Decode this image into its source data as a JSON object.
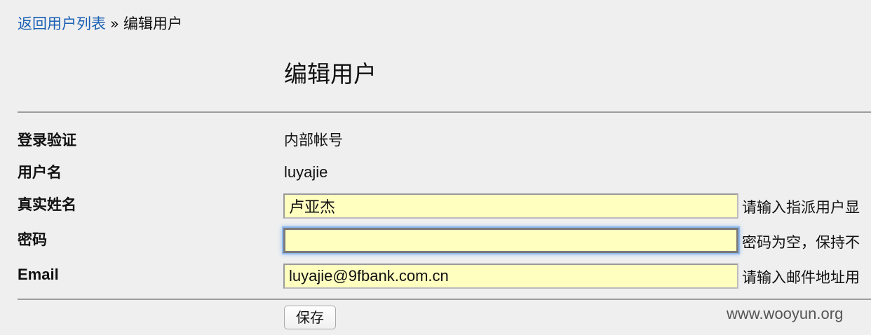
{
  "breadcrumb": {
    "back_link": "返回用户列表",
    "separator": "»",
    "current": "编辑用户"
  },
  "page_title": "编辑用户",
  "form": {
    "auth": {
      "label": "登录验证",
      "value": "内部帐号"
    },
    "username": {
      "label": "用户名",
      "value": "luyajie"
    },
    "realname": {
      "label": "真实姓名",
      "value": "卢亚杰",
      "hint": "请输入指派用户显"
    },
    "password": {
      "label": "密码",
      "value": "",
      "hint": "密码为空，保持不"
    },
    "email": {
      "label": "Email",
      "value": "luyajie@9fbank.com.cn",
      "hint": "请输入邮件地址用"
    },
    "save_label": "保存"
  },
  "watermark": "www.wooyun.org",
  "colors": {
    "link": "#1a5fb4",
    "input_background": "#ffffc0",
    "focus_ring": "#8fb8ee"
  }
}
